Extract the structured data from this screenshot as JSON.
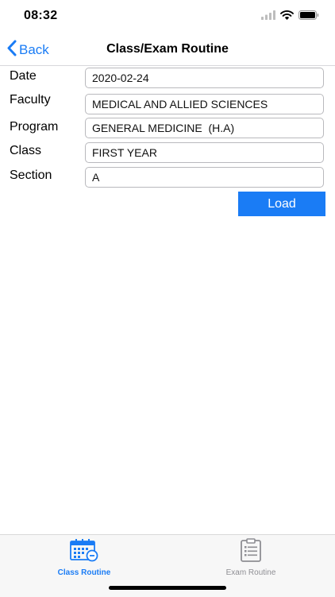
{
  "status_bar": {
    "time": "08:32"
  },
  "nav": {
    "back_label": "Back",
    "title": "Class/Exam Routine"
  },
  "form": {
    "date_label": "Date",
    "date_value": "2020-02-24",
    "faculty_label": "Faculty",
    "faculty_value": "MEDICAL AND ALLIED SCIENCES",
    "program_label": "Program",
    "program_value": "GENERAL MEDICINE  (H.A)",
    "class_label": "Class",
    "class_value": "FIRST YEAR",
    "section_label": "Section",
    "section_value": "A",
    "load_label": "Load"
  },
  "tabs": [
    {
      "label": "Class Routine",
      "icon": "calendar-icon",
      "active": true
    },
    {
      "label": "Exam Routine",
      "icon": "clipboard-icon",
      "active": false
    }
  ],
  "colors": {
    "accent": "#1a7cf5",
    "inactive": "#8e8e93"
  }
}
